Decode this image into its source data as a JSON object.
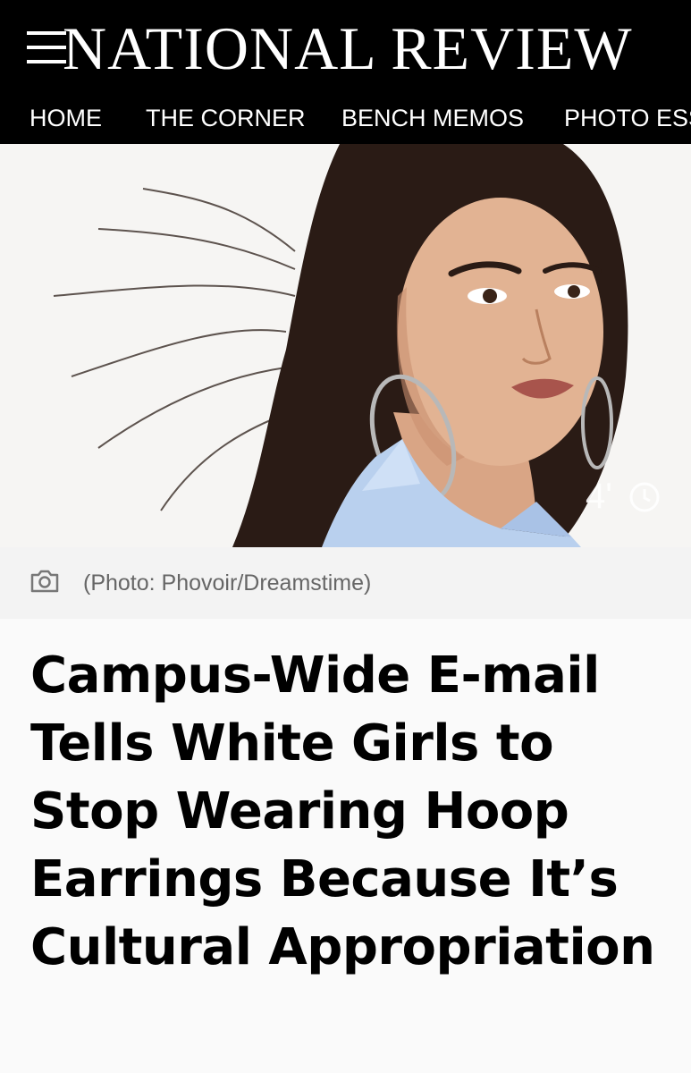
{
  "site": {
    "title": "NATIONAL REVIEW"
  },
  "nav": {
    "items": [
      {
        "label": "HOME"
      },
      {
        "label": "THE CORNER"
      },
      {
        "label": "BENCH MEMOS"
      },
      {
        "label": "PHOTO ESS"
      }
    ]
  },
  "hero": {
    "overlay_text": "4'"
  },
  "caption": {
    "text": "(Photo: Phovoir/Dreamstime)"
  },
  "article": {
    "headline": "Campus-Wide E-mail Tells White Girls to Stop Wearing Hoop Earrings Because It’s Cultural Appropriation"
  },
  "colors": {
    "header_bg": "#000000",
    "header_text": "#ffffff",
    "caption_text": "#666666",
    "headline_text": "#000000"
  }
}
